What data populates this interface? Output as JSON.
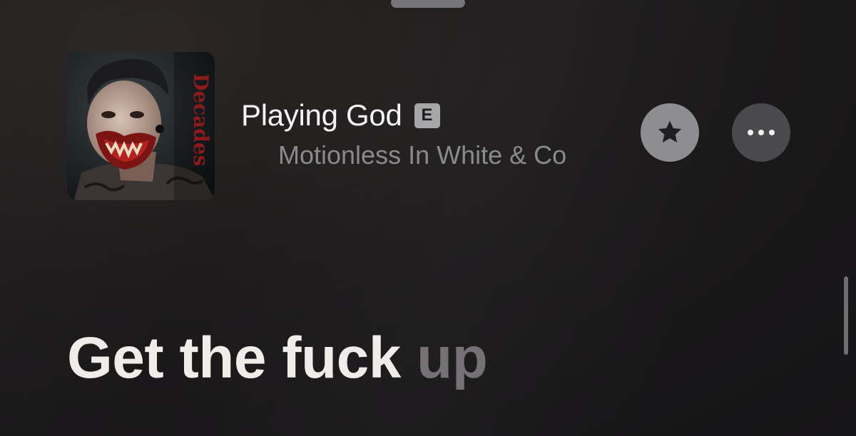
{
  "player": {
    "grabber_icon": "sheet-grabber",
    "artwork_icon": "album-artwork"
  },
  "track": {
    "title": "Playing God",
    "explicit_badge": "E",
    "artist": "Motionless In White & Co"
  },
  "actions": {
    "favorite_icon": "star-icon",
    "more_icon": "ellipsis-icon"
  },
  "lyrics": {
    "sung": "Get the fuck ",
    "upcoming": "up"
  },
  "colors": {
    "background": "#1c1a1b",
    "title": "#f4f4f4",
    "artist": "#8a898c",
    "favorite_button": "#8e8e91",
    "more_button": "#4a494c",
    "lyric_sung": "#f0ecea",
    "lyric_upcoming": "#747275"
  }
}
